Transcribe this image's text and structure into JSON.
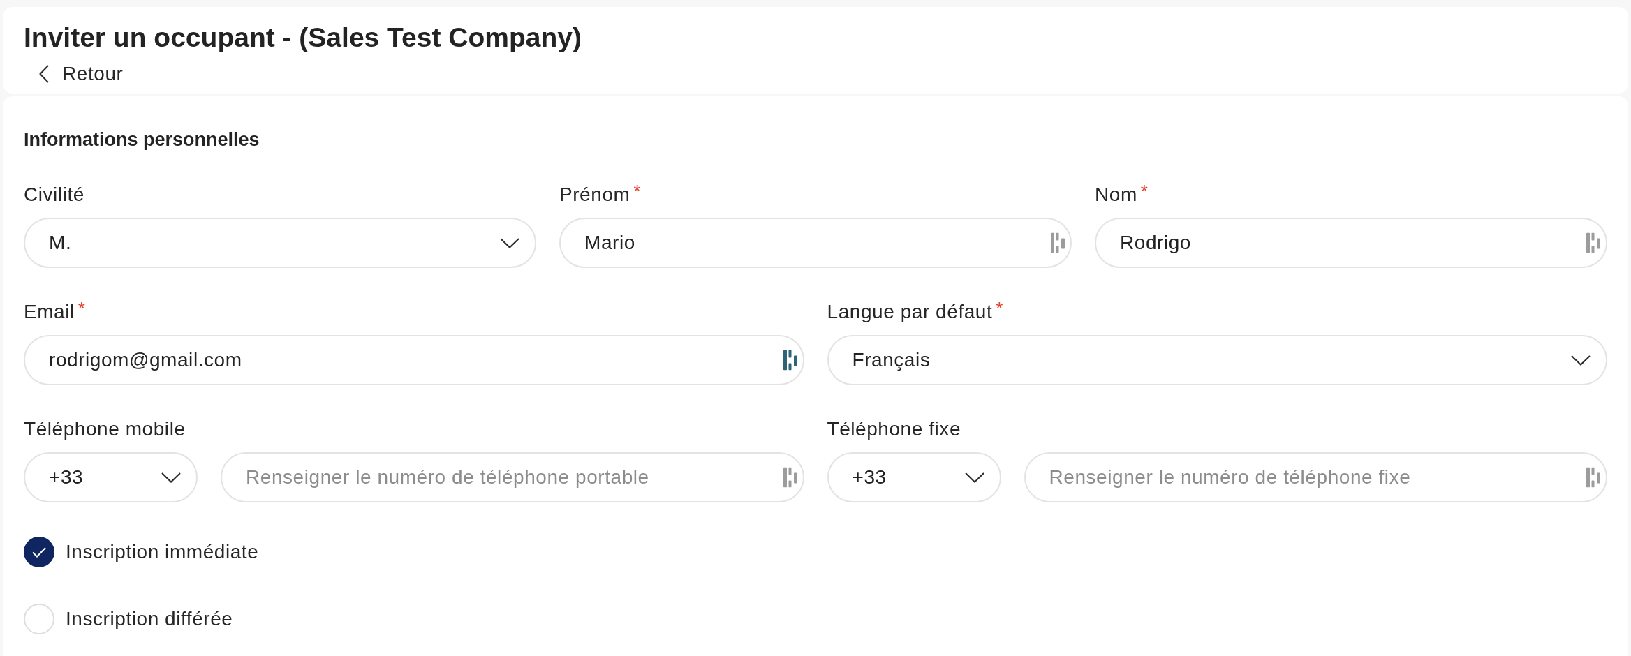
{
  "header": {
    "title": "Inviter un occupant - (Sales Test Company)",
    "back_link": "Retour"
  },
  "personal_info": {
    "title": "Informations personnelles",
    "rows": [
      {
        "fields": [
          {
            "kind": "select",
            "label": "Civilité",
            "value": "M."
          },
          {
            "kind": "text",
            "label": "Prénom",
            "required_mark": "*",
            "value": "Mario",
            "autofill_active": false
          },
          {
            "kind": "text",
            "label": "Nom",
            "required_mark": "*",
            "value": "Rodrigo",
            "autofill_active": false
          }
        ]
      },
      {
        "fields": [
          {
            "kind": "text",
            "label": "Email",
            "required_mark": "*",
            "value": "rodrigom@gmail.com",
            "autofill_active": true
          },
          {
            "kind": "select",
            "label": "Langue par défaut",
            "required_mark": "*",
            "value": "Français"
          }
        ]
      },
      {
        "fields": [
          {
            "kind": "phone",
            "label": "Téléphone mobile",
            "country_code": "+33",
            "placeholder": "Renseigner le numéro de téléphone portable",
            "autofill_active": false
          },
          {
            "kind": "phone",
            "label": "Téléphone fixe",
            "country_code": "+33",
            "placeholder": "Renseigner le numéro de téléphone fixe",
            "autofill_active": false
          }
        ]
      }
    ],
    "registration_options": [
      {
        "label": "Inscription immédiate",
        "selected": true
      },
      {
        "label": "Inscription différée",
        "selected": false
      }
    ]
  }
}
